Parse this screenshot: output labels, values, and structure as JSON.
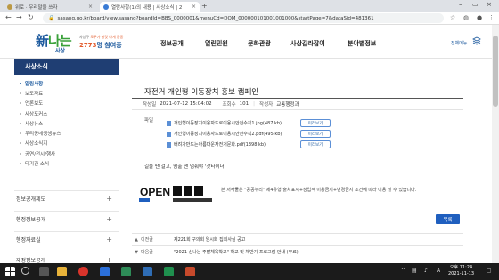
{
  "browser": {
    "tabs": [
      {
        "title": "위로 · 우리말을 쓰자",
        "active": false
      },
      {
        "title": "열람사항(1)의 내용 | 사상소식 | 2",
        "active": true
      }
    ],
    "url": "sasang.go.kr/board/view.sasang?boardId=BBS_0000001&menuCd=DOM_000000101001001000&startPage=7&dataSid=481361"
  },
  "site": {
    "logo_main_1": "新",
    "logo_main_2": "나는",
    "logo_sub": "사상",
    "tagline_1": "사상구",
    "tagline_2": "모두가 살맛 나게 공동",
    "count_prefix": "2773",
    "count_suffix": "명 참여중",
    "gnb": [
      "정보공개",
      "열린민원",
      "문화관광",
      "사상길라잡이",
      "분야별정보"
    ],
    "all_menu": "전체메뉴"
  },
  "sidebar": {
    "title": "사상소식",
    "items": [
      {
        "label": "알림사항",
        "active": true
      },
      {
        "label": "보도자료",
        "active": false
      },
      {
        "label": "언론보도",
        "active": false
      },
      {
        "label": "사상포커스",
        "active": false
      },
      {
        "label": "사상뉴스",
        "active": false
      },
      {
        "label": "우리동네생생뉴스",
        "active": false
      },
      {
        "label": "사상소식지",
        "active": false
      },
      {
        "label": "공연/전시/행사",
        "active": false
      },
      {
        "label": "타기관 소식",
        "active": false
      }
    ],
    "groups": [
      "정보공개제도",
      "행정정보공개",
      "행정자료실",
      "재정정보공개"
    ]
  },
  "article": {
    "title": "자전거 개인형 이동장치 홍보 캠페인",
    "meta_date_label": "작성일",
    "meta_date": "2021-07-12 15:04:02",
    "meta_views_label": "조회수",
    "meta_views": "101",
    "meta_author_label": "작성자",
    "meta_author": "교통행정과",
    "file_label": "파일",
    "files": [
      "개인형이동장치이용자도로이용시안전수칙1.jpg(487 kb)",
      "개인형이동장치이용자도로이용시안전수칙2.pdf(495 kb)",
      "배려가만드는아름다운자전거문화.pdf(1398 kb)"
    ],
    "preview_label": "미리보기",
    "body": "길을 땐 걸고, 멈출 땐 멈춰야 '갓타이더'",
    "license_text": "본 저작물은 \"공공누리\" 제4유형:출처표시+상업적 이용금지+변경금지 조건에 따라 이용 할 수 있습니다.",
    "license_logo": "OPEN",
    "list_button": "목록",
    "prev_label": "이전글",
    "prev_title": "제221회 구의회 임시회 집회사실 공고",
    "next_label": "다음글",
    "next_title": "\"2021 신나는 주말체육학교\" 학교 및 체반기 프로그램 안내 (무료)"
  },
  "taskbar": {
    "time": "오후 11:24",
    "date": "2021-11-13"
  }
}
